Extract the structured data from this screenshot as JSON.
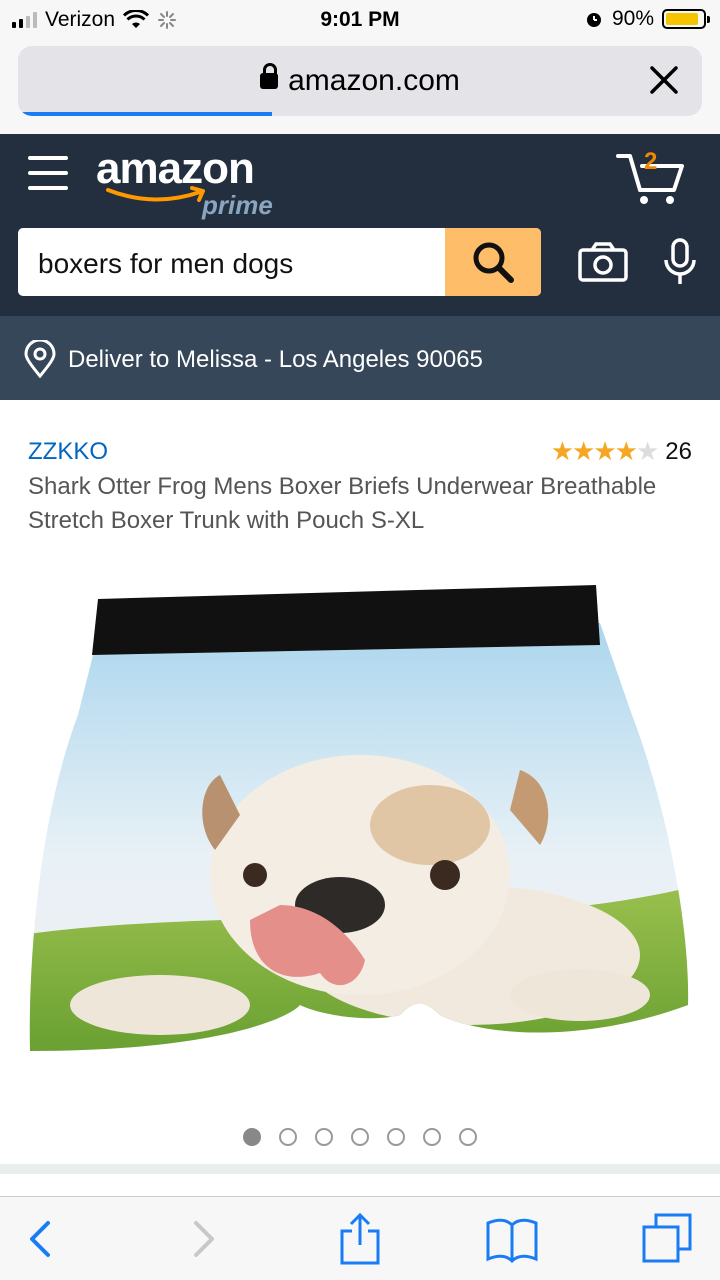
{
  "status_bar": {
    "carrier": "Verizon",
    "time": "9:01 PM",
    "battery": "90%",
    "battery_level": 0.9
  },
  "browser": {
    "domain": "amazon.com"
  },
  "header": {
    "logo_word": "amazon",
    "logo_sub": "prime",
    "cart_count": "2",
    "search_value": "boxers for men dogs"
  },
  "deliver": {
    "label": "Deliver to Melissa - Los Angeles 90065"
  },
  "product": {
    "brand": "ZZKKO",
    "rating_stars": 4,
    "review_count": "26",
    "title": "Shark Otter Frog Mens Boxer Briefs Underwear Breathable Stretch Boxer Trunk with Pouch S-XL",
    "image_total": 7,
    "image_index": 1
  },
  "colors": {
    "header_bg": "#232f3e",
    "deliver_bg": "#37475a",
    "search_button": "#febd69",
    "link_blue": "#0066c0",
    "star": "#f5a623",
    "ios_blue": "#1a7cf5"
  },
  "icons": {
    "menu": "hamburger-icon",
    "cart": "cart-icon",
    "search": "search-icon",
    "camera": "camera-icon",
    "mic": "microphone-icon",
    "location": "location-pin-icon",
    "back": "chevron-left-icon",
    "forward": "chevron-right-icon",
    "share": "share-icon",
    "bookmarks": "book-icon",
    "tabs": "tabs-icon"
  }
}
